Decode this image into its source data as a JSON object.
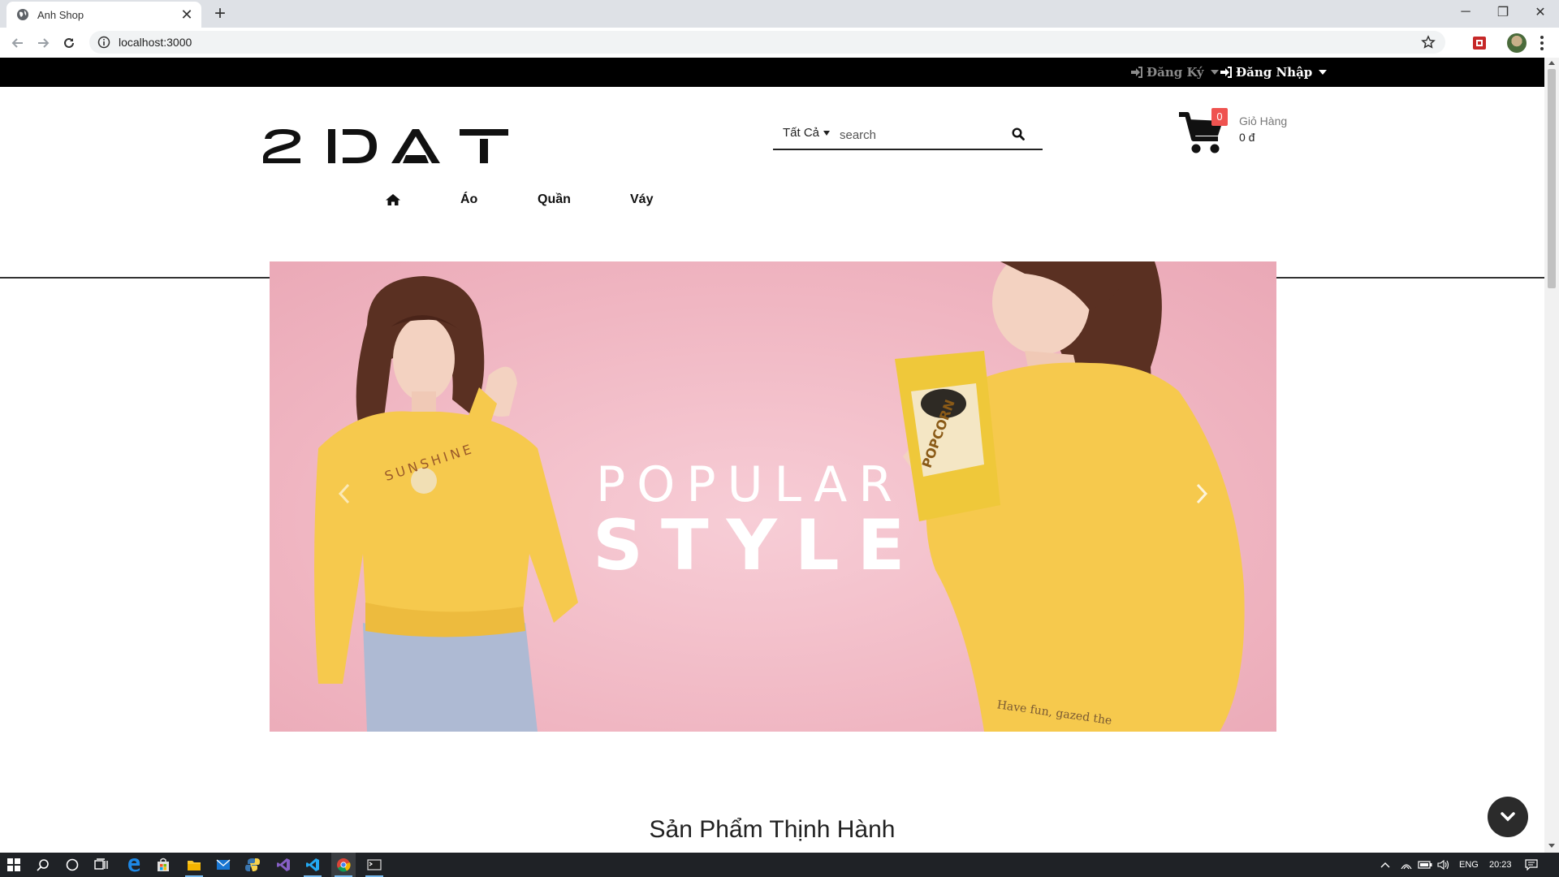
{
  "browser": {
    "tab_title": "Anh Shop",
    "new_tab_label": "+",
    "close_tab_label": "✕",
    "url": "localhost:3000",
    "window_controls": {
      "minimize": "─",
      "maximize": "❐",
      "close": "✕"
    }
  },
  "topbar": {
    "register_label": "Đăng Ký",
    "login_label": "Đăng Nhập"
  },
  "header": {
    "logo_text": "2DAT",
    "search": {
      "category": "Tất Cả",
      "placeholder": "search"
    },
    "cart": {
      "count": "0",
      "label": "Giỏ Hàng",
      "total": "0 đ"
    }
  },
  "menu": {
    "items": [
      {
        "icon": "home-icon"
      },
      {
        "label": "Áo"
      },
      {
        "label": "Quần"
      },
      {
        "label": "Váy"
      }
    ]
  },
  "banner": {
    "line1": "POPULAR",
    "line2": "STYLE",
    "shirt_text": "SUNSHINE",
    "chip_text": "POPCORN",
    "hem_text": "Have fun, gazed the"
  },
  "section": {
    "title": "Sản Phẩm Thịnh Hành"
  },
  "taskbar": {
    "language": "ENG",
    "time": "20:23"
  },
  "colors": {
    "topbar": "#000000",
    "badge": "#ef5350",
    "banner_pink": "#f0b6c2",
    "sweater_yellow": "#f6c94d"
  }
}
